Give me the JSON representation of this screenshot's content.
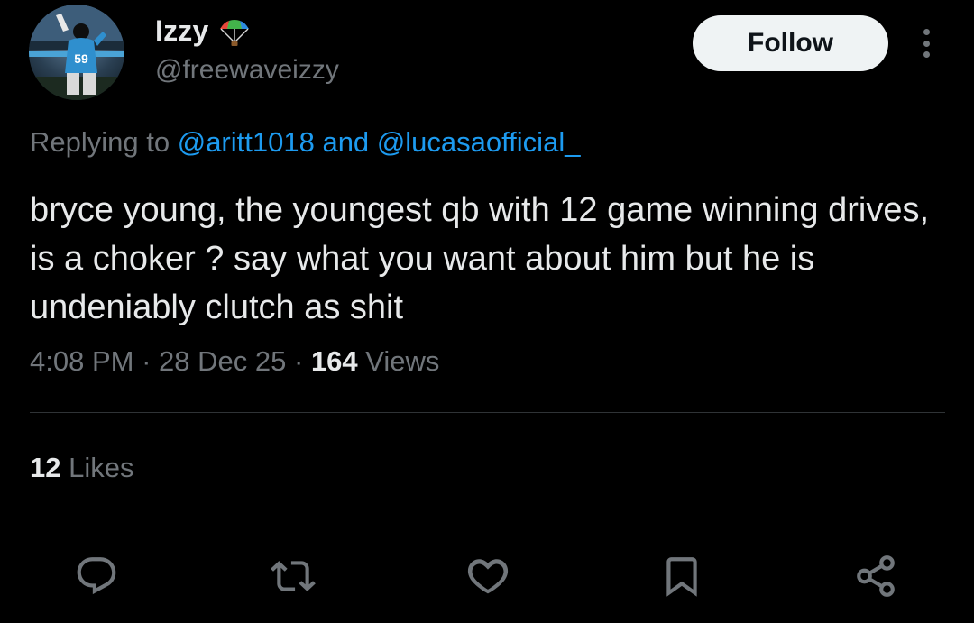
{
  "author": {
    "display_name": "Izzy",
    "name_emoji": "parachute-icon",
    "handle": "@freewaveizzy",
    "avatar": "profile-avatar",
    "jersey_number": "59"
  },
  "follow_label": "Follow",
  "more_icon": "more-vertical-icon",
  "reply_context": {
    "prefix": "Replying to",
    "mention_1": "@aritt1018",
    "joiner": "and",
    "mention_2": "@lucasaofficial_"
  },
  "tweet_text": "bryce young, the youngest qb with 12 game winning drives, is a choker ? say what you want about him but he is undeniably clutch as shit",
  "meta": {
    "time": "4:08 PM",
    "separator": "·",
    "date": "28 Dec 25",
    "views_count": "164",
    "views_label": "Views"
  },
  "stats": {
    "likes_count": "12",
    "likes_label": "Likes"
  },
  "actions": [
    "reply-icon",
    "retweet-icon",
    "like-icon",
    "bookmark-icon",
    "share-icon"
  ],
  "colors": {
    "background": "#000000",
    "primary_text": "#e7e9ea",
    "secondary_text": "#71767b",
    "link": "#1d9bf0",
    "follow_bg": "#eff3f4",
    "divider": "#2f3336"
  }
}
